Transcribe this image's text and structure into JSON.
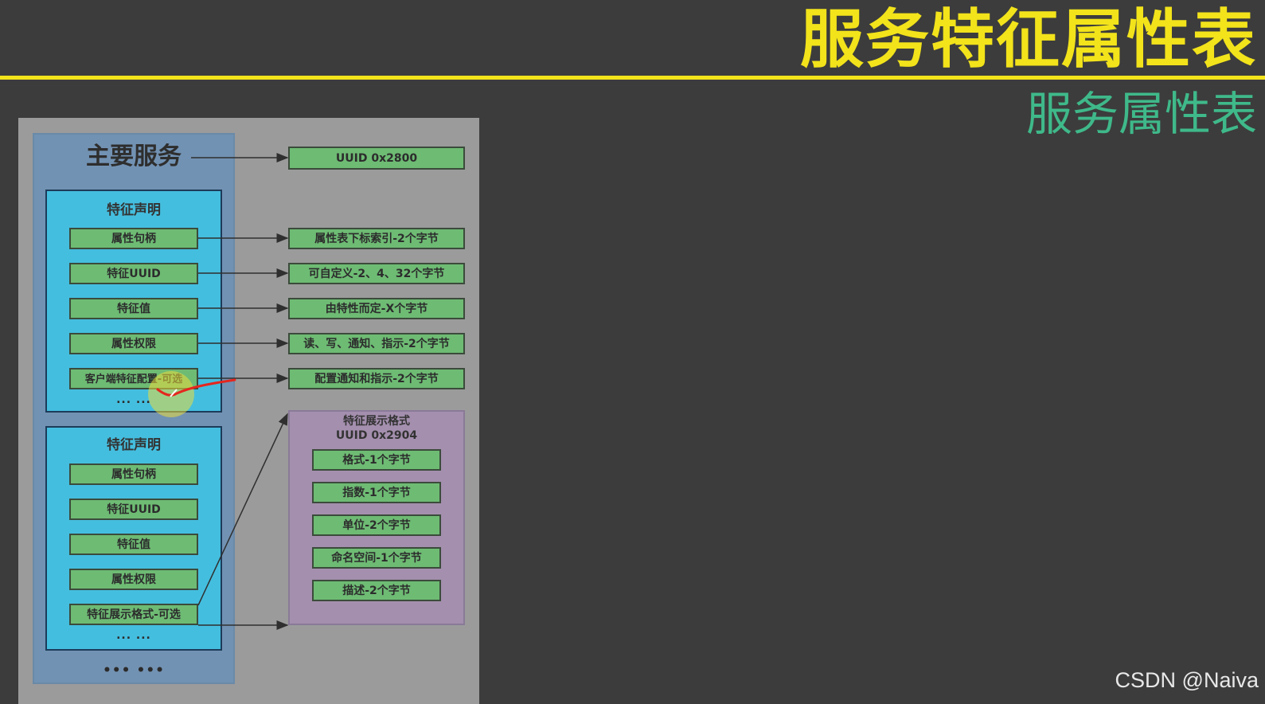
{
  "slide": {
    "title": "服务特征属性表",
    "subtitle": "服务属性表",
    "watermark": "CSDN @Naiva",
    "colors": {
      "title": "#f2e31b",
      "subtitle": "#3fb98a",
      "service": "#7292b3",
      "declaration": "#44bedf",
      "field": "#6ebb74",
      "format_box": "#a48fae",
      "annotation": "#e5261e"
    }
  },
  "diagram": {
    "service_label": "主要服务",
    "service_uuid": "UUID 0x2800",
    "declaration_1": {
      "title": "特征声明",
      "items": [
        "属性句柄",
        "特征UUID",
        "特征值",
        "属性权限",
        "客户端特征配置-可选"
      ],
      "dots": "... ..."
    },
    "declaration_2": {
      "title": "特征声明",
      "items": [
        "属性句柄",
        "特征UUID",
        "特征值",
        "属性权限",
        "特征展示格式-可选"
      ],
      "dots": "... ..."
    },
    "descriptions": [
      "属性表下标索引-2个字节",
      "可自定义-2、4、32个字节",
      "由特性而定-X个字节",
      "读、写、通知、指示-2个字节",
      "配置通知和指示-2个字节"
    ],
    "format": {
      "title": "特征展示格式",
      "uuid": "UUID 0x2904",
      "items": [
        "格式-1个字节",
        "指数-1个字节",
        "单位-2个字节",
        "命名空间-1个字节",
        "描述-2个字节"
      ]
    },
    "bottom_dots": "••• •••"
  }
}
